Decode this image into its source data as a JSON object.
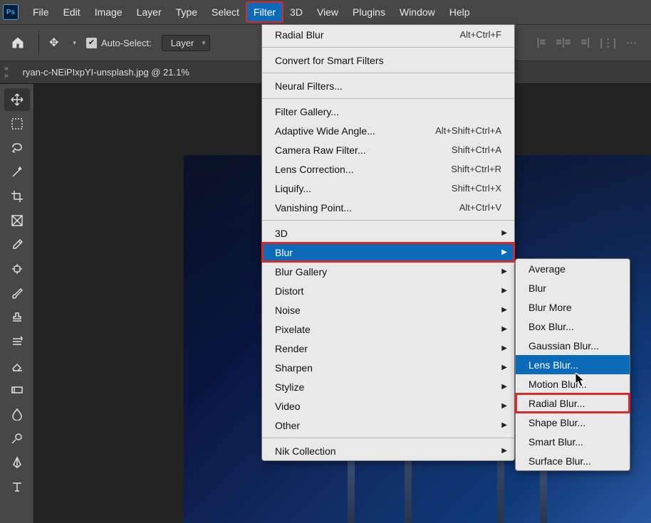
{
  "app": {
    "logo": "Ps"
  },
  "menubar": [
    "File",
    "Edit",
    "Image",
    "Layer",
    "Type",
    "Select",
    "Filter",
    "3D",
    "View",
    "Plugins",
    "Window",
    "Help"
  ],
  "options": {
    "autoSelectLabel": "Auto-Select:",
    "layerSelect": "Layer"
  },
  "tab": {
    "label": "ryan-c-NEiPIxpYI-unsplash.jpg @ 21.1%"
  },
  "filterMenu": {
    "groups": [
      [
        {
          "label": "Radial Blur",
          "shortcut": "Alt+Ctrl+F"
        }
      ],
      [
        {
          "label": "Convert for Smart Filters"
        }
      ],
      [
        {
          "label": "Neural Filters..."
        }
      ],
      [
        {
          "label": "Filter Gallery..."
        },
        {
          "label": "Adaptive Wide Angle...",
          "shortcut": "Alt+Shift+Ctrl+A"
        },
        {
          "label": "Camera Raw Filter...",
          "shortcut": "Shift+Ctrl+A"
        },
        {
          "label": "Lens Correction...",
          "shortcut": "Shift+Ctrl+R"
        },
        {
          "label": "Liquify...",
          "shortcut": "Shift+Ctrl+X"
        },
        {
          "label": "Vanishing Point...",
          "shortcut": "Alt+Ctrl+V"
        }
      ],
      [
        {
          "label": "3D",
          "submenu": true
        },
        {
          "label": "Blur",
          "submenu": true,
          "highlight": true,
          "redbox": true
        },
        {
          "label": "Blur Gallery",
          "submenu": true
        },
        {
          "label": "Distort",
          "submenu": true
        },
        {
          "label": "Noise",
          "submenu": true
        },
        {
          "label": "Pixelate",
          "submenu": true
        },
        {
          "label": "Render",
          "submenu": true
        },
        {
          "label": "Sharpen",
          "submenu": true
        },
        {
          "label": "Stylize",
          "submenu": true
        },
        {
          "label": "Video",
          "submenu": true
        },
        {
          "label": "Other",
          "submenu": true
        }
      ],
      [
        {
          "label": "Nik Collection",
          "submenu": true
        }
      ]
    ]
  },
  "blurSubmenu": [
    {
      "label": "Average"
    },
    {
      "label": "Blur"
    },
    {
      "label": "Blur More"
    },
    {
      "label": "Box Blur..."
    },
    {
      "label": "Gaussian Blur..."
    },
    {
      "label": "Lens Blur...",
      "highlight": true
    },
    {
      "label": "Motion Blur..."
    },
    {
      "label": "Radial Blur...",
      "redbox": true
    },
    {
      "label": "Shape Blur..."
    },
    {
      "label": "Smart Blur..."
    },
    {
      "label": "Surface Blur..."
    }
  ],
  "tools": [
    "move",
    "marquee",
    "lasso",
    "wand",
    "crop",
    "frame",
    "eyedropper",
    "healing",
    "brush",
    "stamp",
    "history",
    "eraser",
    "gradient",
    "blur",
    "dodge",
    "pen",
    "type"
  ]
}
